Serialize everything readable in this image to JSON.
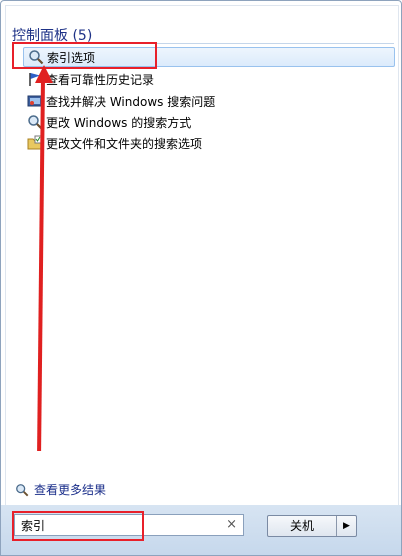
{
  "section": {
    "title": "控制面板 (5)"
  },
  "items": [
    {
      "label": "索引选项",
      "icon": "magnifier-icon",
      "selected": true
    },
    {
      "label": "查看可靠性历史记录",
      "icon": "flag-icon"
    },
    {
      "label": "查找并解决 Windows 搜索问题",
      "icon": "troubleshoot-icon"
    },
    {
      "label": "更改 Windows 的搜索方式",
      "icon": "search-settings-icon"
    },
    {
      "label": "更改文件和文件夹的搜索选项",
      "icon": "folder-options-icon"
    }
  ],
  "more_results": "查看更多结果",
  "search": {
    "value": "索引",
    "clear": "×"
  },
  "shutdown": {
    "label": "关机",
    "arrow": "▶"
  },
  "colors": {
    "accent": "#1e3287",
    "annotation": "#e8202a"
  }
}
